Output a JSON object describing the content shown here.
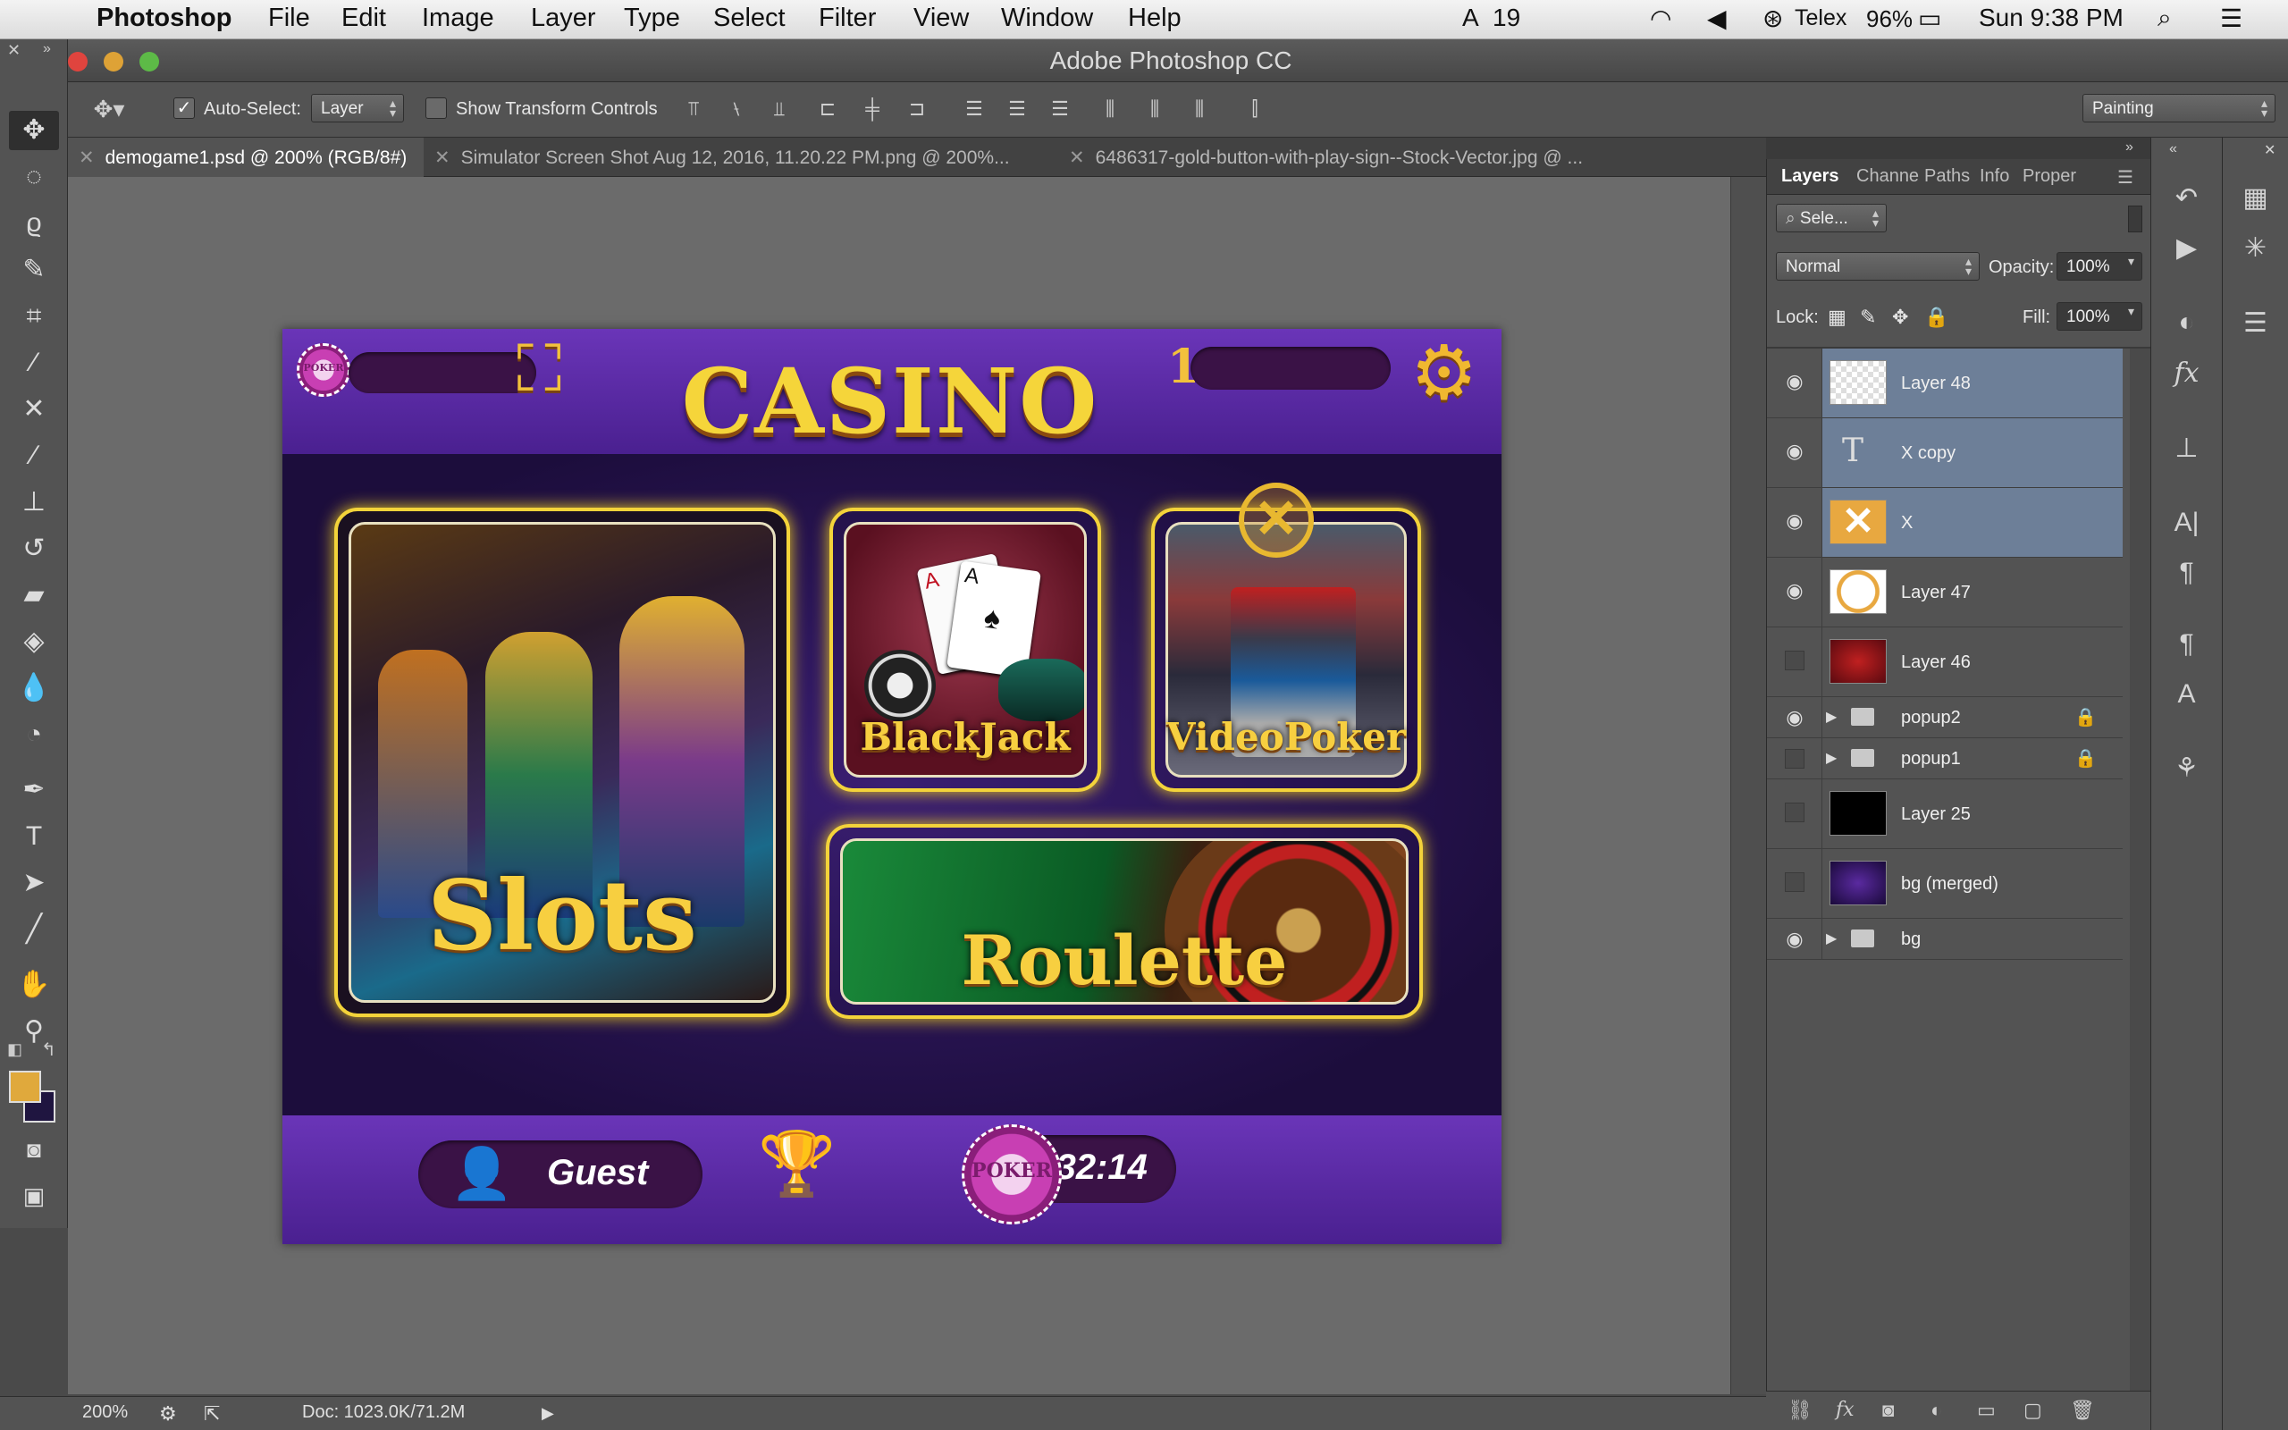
{
  "menubar": {
    "app_name": "Photoshop",
    "menus": [
      "File",
      "Edit",
      "Image",
      "Layer",
      "Type",
      "Select",
      "Filter",
      "View",
      "Window",
      "Help"
    ],
    "status_count": "19",
    "input_source": "Telex",
    "battery": "96%",
    "clock": "Sun 9:38 PM"
  },
  "window": {
    "title": "Adobe Photoshop CC"
  },
  "options_bar": {
    "auto_select_label": "Auto-Select:",
    "auto_select_checked": true,
    "auto_select_target": "Layer",
    "show_transform_label": "Show Transform Controls",
    "show_transform_checked": false,
    "workspace": "Painting"
  },
  "tabs": [
    {
      "label": "demogame1.psd @ 200% (RGB/8#)",
      "active": true
    },
    {
      "label": "Simulator Screen Shot Aug 12, 2016, 11.20.22 PM.png @ 200%...",
      "active": false
    },
    {
      "label": "6486317-gold-button-with-play-sign--Stock-Vector.jpg @ ...",
      "active": false
    }
  ],
  "canvas": {
    "title": "CASINO",
    "chip_label": "POKER",
    "level": "1",
    "cards": {
      "slots": "Slots",
      "blackjack": "BlackJack",
      "video_poker": "VideoPoker",
      "roulette": "Roulette"
    },
    "player_name": "Guest",
    "timer": "0:32:14"
  },
  "status_bar": {
    "zoom": "200%",
    "doc_size": "Doc: 1023.0K/71.2M"
  },
  "layers_panel": {
    "tabs": [
      "Layers",
      "Channe",
      "Paths",
      "Info",
      "Proper"
    ],
    "filter_placeholder": "Sele...",
    "blend_mode": "Normal",
    "opacity_label": "Opacity:",
    "opacity": "100%",
    "lock_label": "Lock:",
    "fill_label": "Fill:",
    "fill": "100%",
    "layers": [
      {
        "name": "Layer 48",
        "visible": true,
        "selected": true,
        "kind": "pixel"
      },
      {
        "name": "X copy",
        "visible": true,
        "selected": true,
        "kind": "text"
      },
      {
        "name": "X",
        "visible": true,
        "selected": true,
        "kind": "pixel"
      },
      {
        "name": "Layer 47",
        "visible": true,
        "selected": false,
        "kind": "pixel"
      },
      {
        "name": "Layer 46",
        "visible": false,
        "selected": false,
        "kind": "pixel"
      },
      {
        "name": "popup2",
        "visible": true,
        "selected": false,
        "kind": "group",
        "locked": true
      },
      {
        "name": "popup1",
        "visible": false,
        "selected": false,
        "kind": "group",
        "locked": true
      },
      {
        "name": "Layer 25",
        "visible": false,
        "selected": false,
        "kind": "pixel"
      },
      {
        "name": "bg (merged)",
        "visible": false,
        "selected": false,
        "kind": "pixel"
      },
      {
        "name": "bg",
        "visible": true,
        "selected": false,
        "kind": "group"
      }
    ]
  },
  "colors": {
    "foreground": "#e0a93c",
    "background": "#1f1540",
    "accent_gold": "#f3d33a",
    "purple": "#5a2aa0"
  }
}
